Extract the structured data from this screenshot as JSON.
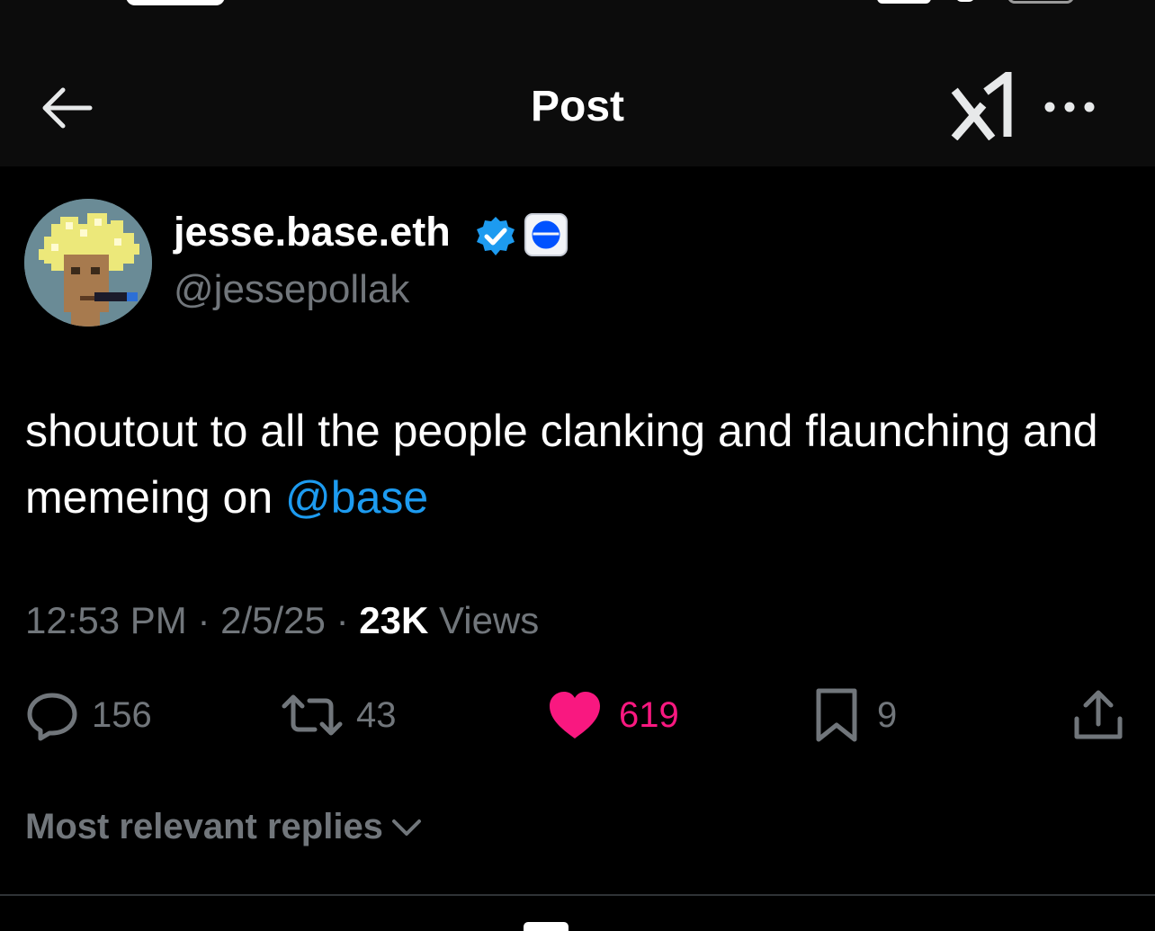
{
  "header": {
    "title": "Post"
  },
  "post": {
    "author": {
      "display_name": "jesse.base.eth",
      "handle": "@jessepollak",
      "verified": true
    },
    "text_before_mention": "shoutout to all the people clanking and flaunching and memeing on ",
    "mention": "@base",
    "time": "12:53 PM",
    "separator": "·",
    "date": "2/5/25",
    "views_count": "23K",
    "views_label": "Views"
  },
  "actions": {
    "replies": "156",
    "reposts": "43",
    "likes": "619",
    "bookmarks": "9"
  },
  "replies_sort": {
    "label": "Most relevant replies"
  },
  "icons": {
    "back": "arrow-left-icon",
    "grok": "grok-icon",
    "more": "more-dots-icon",
    "verified": "verified-badge-icon",
    "affiliation": "base-affiliate-icon",
    "reply": "reply-bubble-icon",
    "repost": "repost-icon",
    "like": "heart-icon",
    "bookmark": "bookmark-icon",
    "share": "share-icon",
    "chevron": "chevron-down-icon"
  },
  "colors": {
    "background": "#000000",
    "header_background": "#0c0c0c",
    "text_primary": "#ffffff",
    "text_secondary": "#71767b",
    "link": "#1d9bf0",
    "like": "#f91880",
    "verified": "#1d9bf0"
  }
}
